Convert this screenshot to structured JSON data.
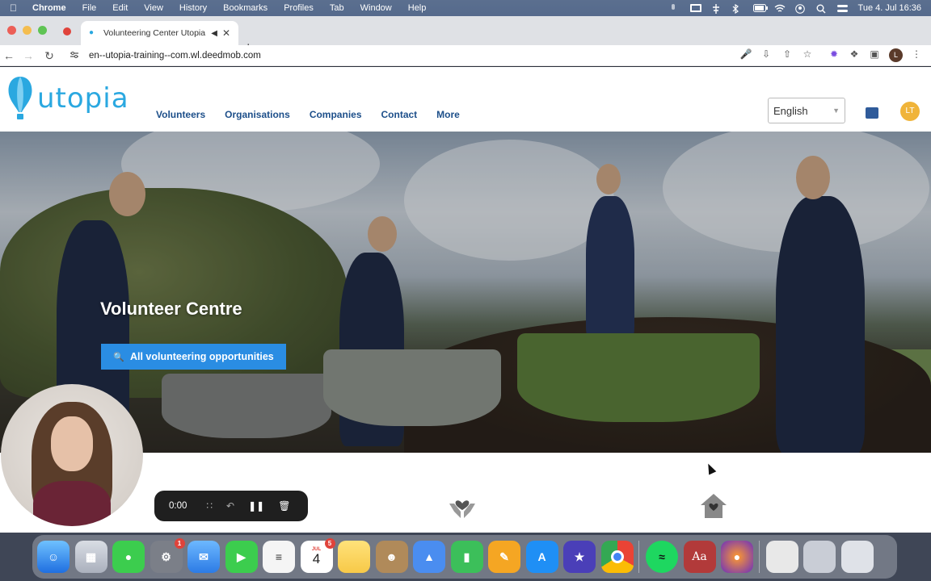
{
  "menubar": {
    "app_name": "Chrome",
    "items": [
      "File",
      "Edit",
      "View",
      "History",
      "Bookmarks",
      "Profiles",
      "Tab",
      "Window",
      "Help"
    ],
    "clock": "Tue 4. Jul  16:36"
  },
  "browser": {
    "tab_title": "Volunteering Center Utopia",
    "url": "en--utopia-training--com.wl.deedmob.com",
    "profile_initial": "L"
  },
  "site": {
    "logo_text": "utopia",
    "nav": [
      "Volunteers",
      "Organisations",
      "Companies",
      "Contact",
      "More"
    ],
    "language": "English",
    "user_initials": "LT"
  },
  "hero": {
    "title": "Volunteer Centre",
    "button_label": "All volunteering opportunities"
  },
  "recorder": {
    "time": "0:00"
  },
  "dock": {
    "calendar_month": "JUL",
    "calendar_day": "4",
    "calendar_badge": "5",
    "settings_badge": "1",
    "dictionary_label": "Aa"
  },
  "colors": {
    "brand_blue": "#2aa8e0",
    "nav_blue": "#1d4f8a",
    "button_blue": "#2a8de3",
    "avatar_gold": "#f0b43a"
  }
}
